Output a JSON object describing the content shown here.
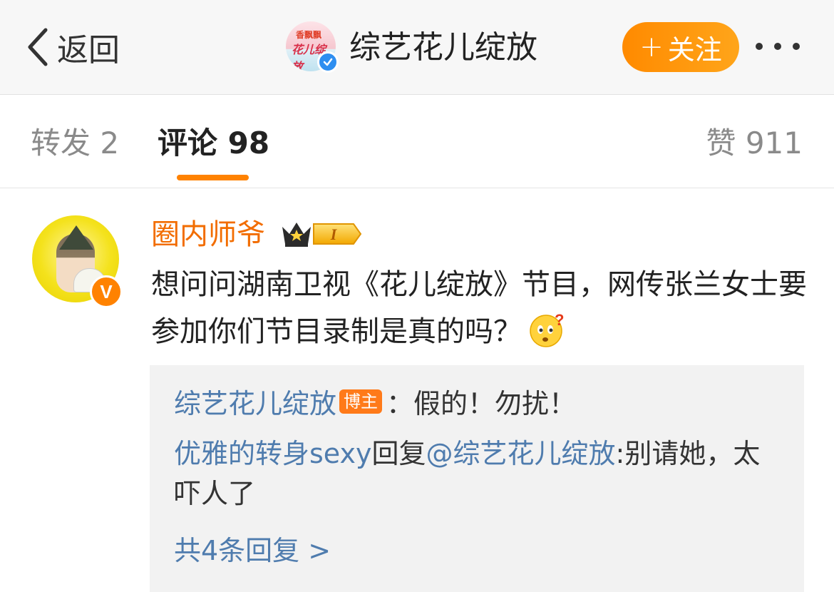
{
  "header": {
    "back_label": "返回",
    "account_name": "综艺花儿绽放",
    "avatar_logo_top": "香飘飘",
    "avatar_logo_bottom": "花儿绽放",
    "follow_plus": "+",
    "follow_label": "关注"
  },
  "tabs": {
    "repost": "转发 2",
    "comment": "评论 98",
    "like": "赞 911"
  },
  "comment": {
    "author": "圈内师爷",
    "vip_mark": "V",
    "rank_level": "I",
    "text": "想问问湖南卫视《花儿绽放》节目，网传张兰女士要参加你们节目录制是真的吗？"
  },
  "replies": {
    "items": [
      {
        "author": "综艺花儿绽放",
        "tag": "博主",
        "text": "：假的！勿扰！"
      },
      {
        "author": "优雅的转身sexy",
        "reply_word": "回复",
        "mention": "@综艺花儿绽放",
        "text": ":别请她，太吓人了"
      }
    ],
    "more_label": "共4条回复 >"
  },
  "colors": {
    "accent_orange": "#ff8200",
    "link_blue": "#4f7cae",
    "author_orange": "#f26d00"
  },
  "icons": [
    "back-chevron-icon",
    "verified-icon",
    "more-dots-icon",
    "crown-rank-icon",
    "thinking-face-icon"
  ]
}
